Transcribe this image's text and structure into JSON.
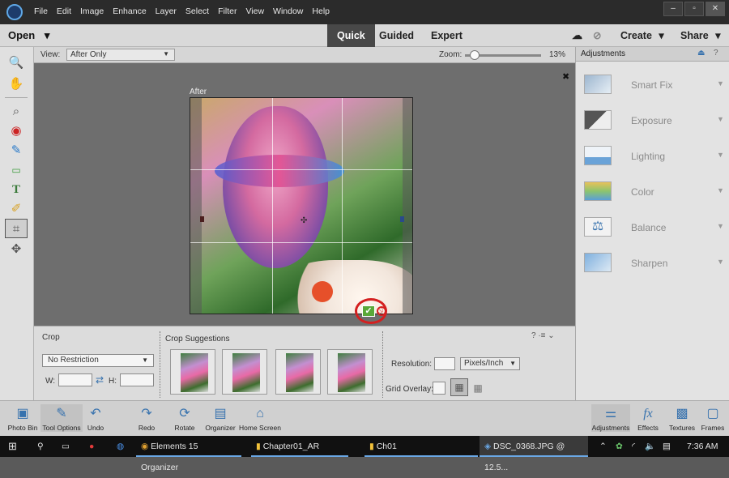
{
  "menubar": {
    "items": [
      "File",
      "Edit",
      "Image",
      "Enhance",
      "Layer",
      "Select",
      "Filter",
      "View",
      "Window",
      "Help"
    ],
    "window_controls": [
      "–",
      "▫",
      "✕"
    ]
  },
  "modebar": {
    "open_label": "Open",
    "open_caret": "▾",
    "tabs": [
      "Quick",
      "Guided",
      "Expert"
    ],
    "active_tab": "Quick",
    "create_label": "Create",
    "share_label": "Share",
    "caret": "▾"
  },
  "options_row": {
    "view_label": "View:",
    "view_value": "After Only",
    "zoom_label": "Zoom:",
    "zoom_value": "13%",
    "zoom_level": 0.13
  },
  "canvas": {
    "image_label": "After",
    "close_glyph": "✖"
  },
  "crop_panel": {
    "title": "Crop",
    "suggestions_title": "Crop Suggestions",
    "restriction_value": "No Restriction",
    "w_label": "W:",
    "h_label": "H:",
    "swap_glyph": "⇄",
    "resolution_label": "Resolution:",
    "resolution_units": "Pixels/Inch",
    "grid_overlay_label": "Grid Overlay:",
    "help_glyph": "? ·≡ ⌄"
  },
  "adjustments": {
    "header": "Adjustments",
    "items": [
      {
        "label": "Smart Fix"
      },
      {
        "label": "Exposure"
      },
      {
        "label": "Lighting"
      },
      {
        "label": "Color"
      },
      {
        "label": "Balance"
      },
      {
        "label": "Sharpen"
      }
    ]
  },
  "bottom_bar": {
    "left": [
      "Photo Bin",
      "Tool Options",
      "Undo",
      "Redo",
      "Rotate",
      "Organizer",
      "Home Screen"
    ],
    "right": [
      "Adjustments",
      "Effects",
      "Textures",
      "Frames"
    ]
  },
  "windows_taskbar": {
    "tasks": [
      "Elements 15 Organizer",
      "Chapter01_AR",
      "Ch01",
      "DSC_0368.JPG @ 12.5..."
    ],
    "time": "7:36 AM"
  },
  "colors": {
    "accent_red": "#d42020",
    "commit_green": "#5aa838"
  }
}
